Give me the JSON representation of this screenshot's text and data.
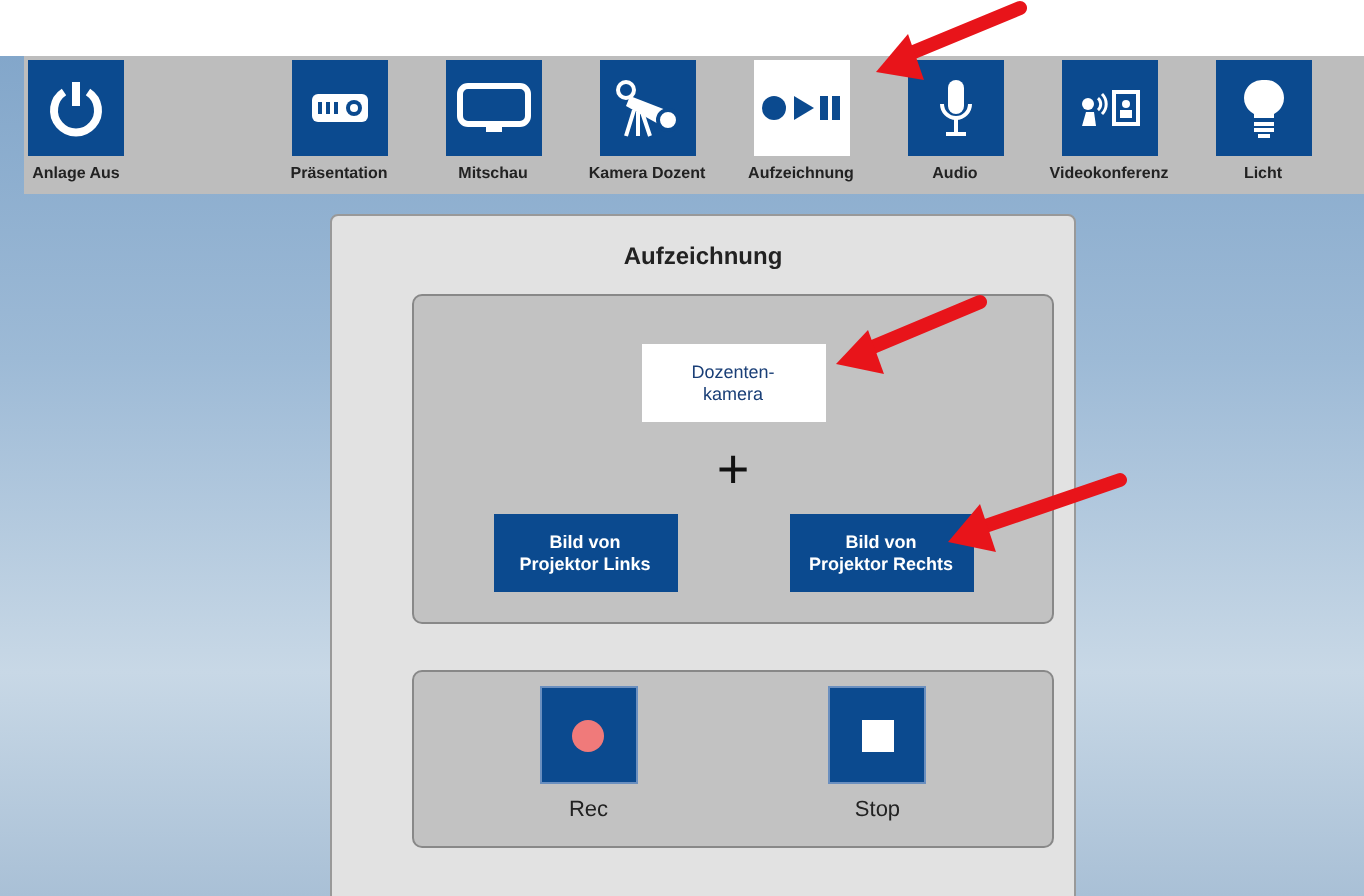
{
  "toolbar": [
    {
      "label": "Anlage Aus",
      "kind": "power",
      "selected": false
    },
    {
      "label": "Präsentation",
      "kind": "projector",
      "selected": false
    },
    {
      "label": "Mitschau",
      "kind": "monitor",
      "selected": false
    },
    {
      "label": "Kamera Dozent",
      "kind": "camera",
      "selected": false
    },
    {
      "label": "Aufzeichnung",
      "kind": "record",
      "selected": true
    },
    {
      "label": "Audio",
      "kind": "microphone",
      "selected": false
    },
    {
      "label": "Videokonferenz",
      "kind": "video",
      "selected": false
    },
    {
      "label": "Licht",
      "kind": "bulb",
      "selected": false
    }
  ],
  "panel": {
    "title": "Aufzeichnung",
    "camera_source": {
      "label": "Dozenten-\nkamera",
      "selected": true
    },
    "plus": "+",
    "projector_sources": [
      {
        "label": "Bild von\nProjektor Links",
        "selected": false
      },
      {
        "label": "Bild von\nProjektor Rechts",
        "selected": false
      }
    ],
    "controls": [
      {
        "label": "Rec",
        "kind": "record"
      },
      {
        "label": "Stop",
        "kind": "stop"
      }
    ]
  }
}
